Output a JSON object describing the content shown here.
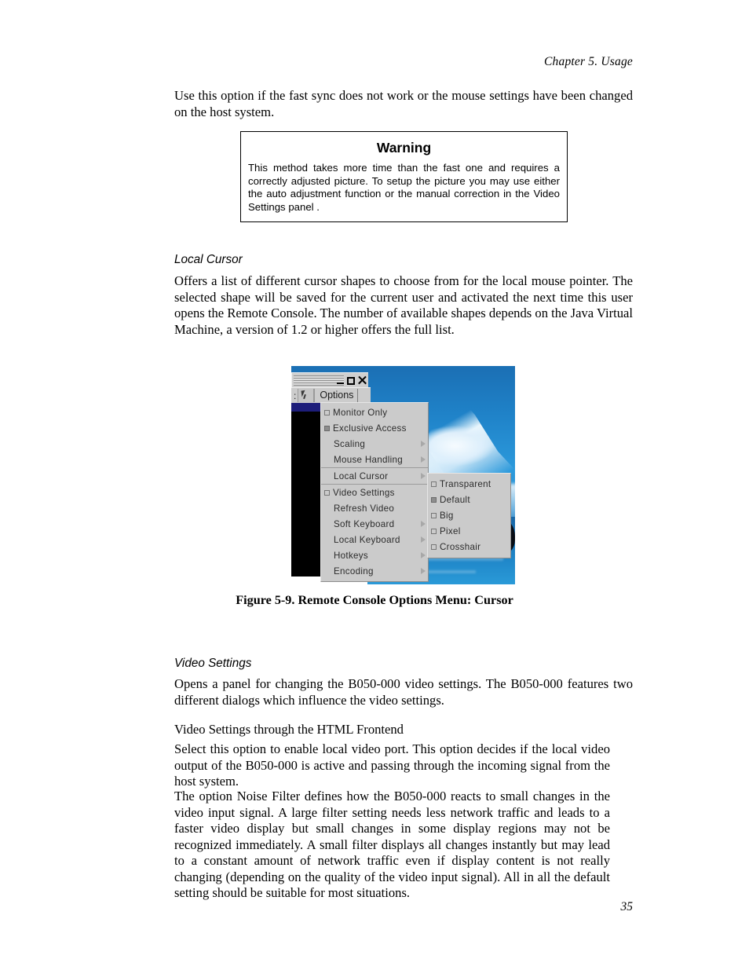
{
  "page": {
    "running_head": "Chapter 5. Usage",
    "folio": "35"
  },
  "intro_paragraph": "Use this option if the fast sync does not work or the mouse settings have been changed on the host system.",
  "warning": {
    "title": "Warning",
    "text": "This method takes more time than the fast one and requires a correctly adjusted picture. To setup the picture you may use either the auto adjustment function or the manual correction in the Video Settings panel ."
  },
  "local_cursor": {
    "heading": "Local Cursor",
    "paragraph": "Offers a list of different cursor shapes to choose from for the local mouse pointer. The selected shape will be saved for the current user and activated the next time this user opens the Remote Console. The number of available shapes depends on the Java Virtual Machine, a version of 1.2 or higher offers the full list."
  },
  "figure": {
    "caption": "Figure 5-9. Remote Console Options Menu: Cursor",
    "window": {
      "menubar_prefix": ":",
      "cursor_button_icon": "mouse-cursor-icon",
      "options_label": "Options",
      "minimize_icon": "minimize-icon",
      "maximize_icon": "maximize-icon",
      "close_icon": "close-icon"
    },
    "menu": {
      "items": [
        {
          "label": "Monitor Only",
          "checkbox": "unchecked",
          "arrow": false
        },
        {
          "label": "Exclusive Access",
          "checkbox": "checked",
          "arrow": false
        },
        {
          "label": "Scaling",
          "checkbox": "none",
          "arrow": true
        },
        {
          "label": "Mouse Handling",
          "checkbox": "none",
          "arrow": true
        },
        {
          "label": "Local Cursor",
          "checkbox": "none",
          "arrow": true,
          "selected": true
        },
        {
          "label": "Video Settings",
          "checkbox": "unchecked",
          "arrow": false
        },
        {
          "label": "Refresh Video",
          "checkbox": "none",
          "arrow": false
        },
        {
          "label": "Soft Keyboard",
          "checkbox": "none",
          "arrow": true
        },
        {
          "label": "Local Keyboard",
          "checkbox": "none",
          "arrow": true
        },
        {
          "label": "Hotkeys",
          "checkbox": "none",
          "arrow": true
        },
        {
          "label": "Encoding",
          "checkbox": "none",
          "arrow": true
        }
      ]
    },
    "submenu": {
      "items": [
        {
          "label": "Transparent",
          "checkbox": "unchecked"
        },
        {
          "label": "Default",
          "checkbox": "checked"
        },
        {
          "label": "Big",
          "checkbox": "unchecked"
        },
        {
          "label": "Pixel",
          "checkbox": "unchecked"
        },
        {
          "label": "Crosshair",
          "checkbox": "unchecked"
        }
      ]
    },
    "colors": {
      "menu_background": "#cbcbcb",
      "desktop_sky": "#1f82c8",
      "console_background": "#000000",
      "titlebar_accent": "#1d1d7a"
    }
  },
  "video_settings": {
    "heading": "Video Settings",
    "paragraph": "Opens a panel for changing the B050-000 video settings. The B050-000 features two different dialogs which influence the video settings.",
    "subheading": "Video Settings through the HTML Frontend",
    "paragraph_1": "Select this option to enable local video port. This option decides if the local video output of the B050-000 is active and passing through the incoming signal from the host system.",
    "paragraph_2": "The option Noise Filter defines how the B050-000 reacts to small changes in the video input signal. A large filter setting needs less network traffic and leads to a faster video display but small changes in some display regions may not be recognized immediately. A small filter displays all changes instantly but may lead to a constant amount of network traffic even if display content is not really changing (depending on the quality of the video input signal). All in all the default setting should be suitable for most situations."
  }
}
